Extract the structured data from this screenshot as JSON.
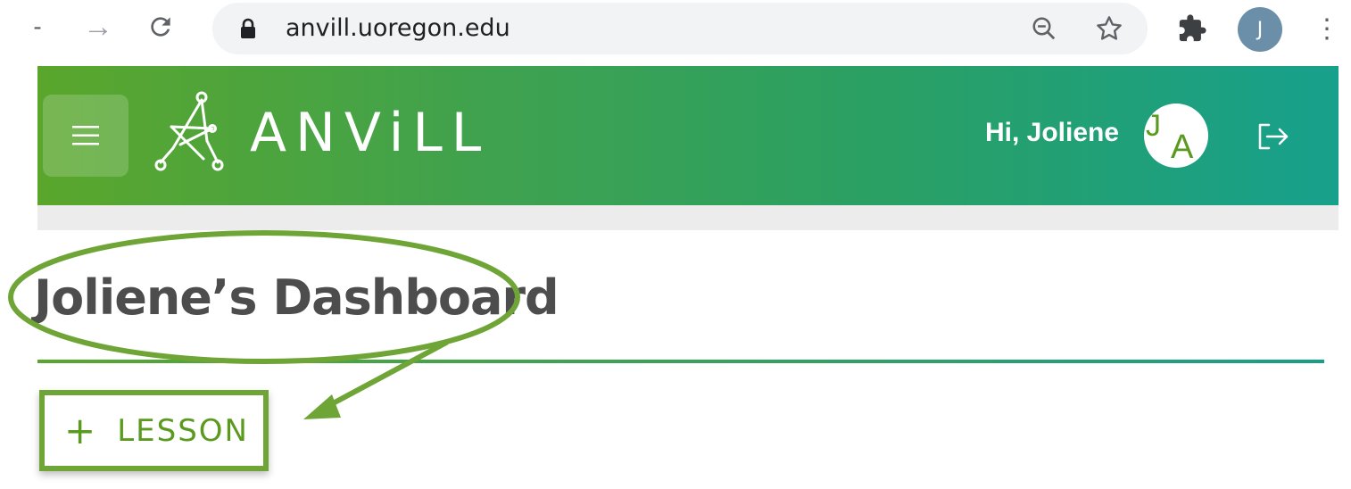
{
  "browser": {
    "url": "anvill.uoregon.edu",
    "profile_initial": "J",
    "back_glyph": "-",
    "forward_glyph": "→",
    "reload_glyph": "C",
    "menu_glyph": "⋮"
  },
  "header": {
    "brand": "ANViLL",
    "greeting": "Hi, Joliene",
    "avatar_initials": {
      "first": "J",
      "last": "A"
    },
    "icons": {
      "menu": "hamburger-menu-icon",
      "logo": "network-figure-logo",
      "logout": "logout-icon"
    }
  },
  "main": {
    "title": "Joliene’s Dashboard",
    "add_lesson": {
      "plus": "+",
      "label": "LESSON"
    }
  },
  "colors": {
    "brand_green": "#5aa62c",
    "brand_teal": "#17a08c",
    "title_text": "#4d4d4d",
    "annotation": "#6fa536"
  }
}
